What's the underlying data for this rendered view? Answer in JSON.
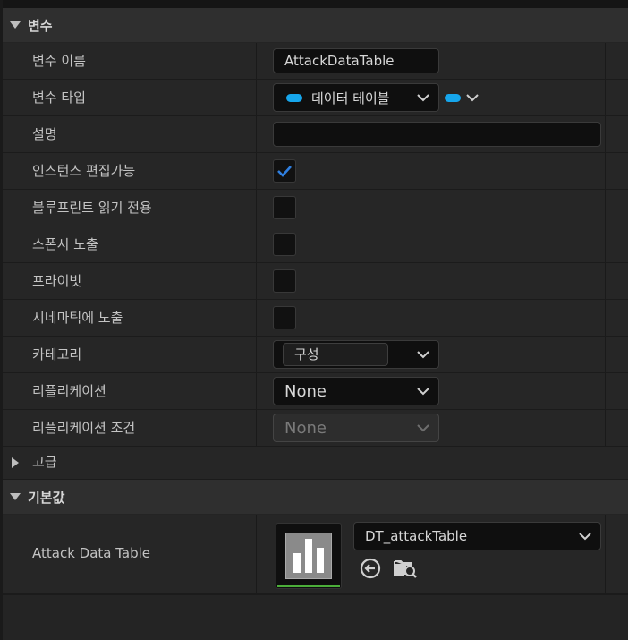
{
  "sections": {
    "variables": "변수",
    "advanced": "고급",
    "defaults": "기본값"
  },
  "rows": {
    "var_name": {
      "label": "변수 이름",
      "value": "AttackDataTable"
    },
    "var_type": {
      "label": "변수 타입",
      "value": "데이터 테이블"
    },
    "description": {
      "label": "설명",
      "value": ""
    },
    "instance_editable": {
      "label": "인스턴스 편집가능",
      "checked": true
    },
    "bp_readonly": {
      "label": "블루프린트 읽기 전용",
      "checked": false
    },
    "expose_spawn": {
      "label": "스폰시 노출",
      "checked": false
    },
    "private": {
      "label": "프라이빗",
      "checked": false
    },
    "expose_cinematics": {
      "label": "시네마틱에 노출",
      "checked": false
    },
    "category": {
      "label": "카테고리",
      "value": "구성"
    },
    "replication": {
      "label": "리플리케이션",
      "value": "None"
    },
    "replication_condition": {
      "label": "리플리케이션 조건",
      "value": "None"
    },
    "attack_data_table": {
      "label": "Attack Data Table",
      "value": "DT_attackTable"
    }
  },
  "colors": {
    "pin_color": "#16a6ec",
    "check_color": "#2f7fe0",
    "thumb_underline": "#4caf3a"
  },
  "icons": {
    "browse": "arrow-left-circle-icon",
    "find": "folder-search-icon"
  }
}
